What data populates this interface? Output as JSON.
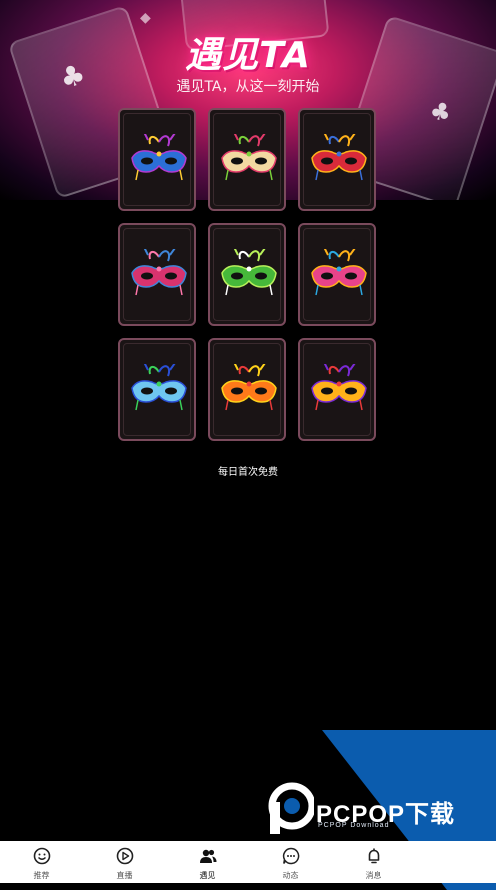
{
  "hero": {
    "title": "遇见TA",
    "subtitle": "遇见TA，从这一刻开始"
  },
  "masks": [
    {
      "name": "mask-blue-butterfly",
      "primary": "#2b6fd6",
      "secondary": "#b23ad1",
      "accent": "#ffcc33"
    },
    {
      "name": "mask-gold-feather",
      "primary": "#f2d9a2",
      "secondary": "#e23b6a",
      "accent": "#7ad13a"
    },
    {
      "name": "mask-red-gold",
      "primary": "#d92a3a",
      "secondary": "#ffb21a",
      "accent": "#3a6fd9"
    },
    {
      "name": "mask-pink-feather",
      "primary": "#d8336e",
      "secondary": "#3f86d9",
      "accent": "#ff77aa"
    },
    {
      "name": "mask-green",
      "primary": "#46b83a",
      "secondary": "#b8f05a",
      "accent": "#ffffff"
    },
    {
      "name": "mask-pink-jewel",
      "primary": "#e8438a",
      "secondary": "#ffb21a",
      "accent": "#2ba8e0"
    },
    {
      "name": "mask-blue-white",
      "primary": "#6fc6f0",
      "secondary": "#2a4fd6",
      "accent": "#3ad15a"
    },
    {
      "name": "mask-orange-gold",
      "primary": "#ff7a1a",
      "secondary": "#ffd21a",
      "accent": "#e83a3a"
    },
    {
      "name": "mask-gold-purple",
      "primary": "#ffb21a",
      "secondary": "#7a2ad6",
      "accent": "#e83a3a"
    }
  ],
  "hint": "每日首次免费",
  "tabs": [
    {
      "label": "推荐",
      "icon": "smile-icon"
    },
    {
      "label": "直播",
      "icon": "play-icon"
    },
    {
      "label": "遇见",
      "icon": "users-icon",
      "active": true
    },
    {
      "label": "动态",
      "icon": "chat-icon"
    },
    {
      "label": "消息",
      "icon": "bell-icon"
    }
  ],
  "watermark": {
    "brand": "PCPOP下载",
    "sub": "PCPOP Download"
  },
  "colors": {
    "accent_pink": "#ff2a8a",
    "tile_border": "#7a4a5c",
    "watermark_blue": "#0b5cae"
  }
}
